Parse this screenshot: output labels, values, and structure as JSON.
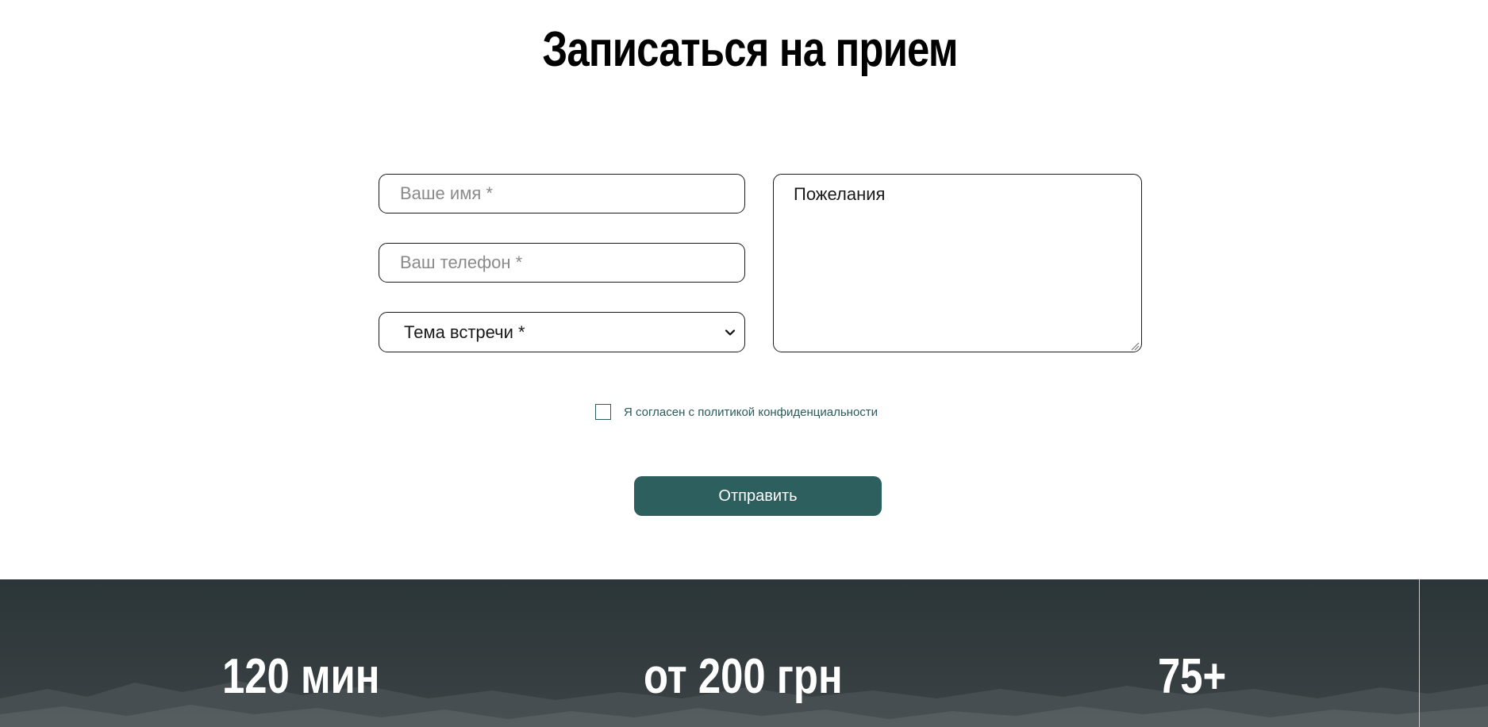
{
  "form": {
    "title": "Записаться на прием",
    "name_placeholder": "Ваше имя *",
    "phone_placeholder": "Ваш телефон *",
    "topic_selected": "Тема встречи *",
    "wishes_placeholder": "Пожелания",
    "consent_label": "Я согласен с политикой конфиденциальности",
    "consent_checked": false,
    "submit_label": "Отправить"
  },
  "stats": {
    "items": [
      {
        "value": "120 мин"
      },
      {
        "value": "от 200 грн"
      },
      {
        "value": "75+"
      }
    ]
  },
  "colors": {
    "accent": "#2c5f5d",
    "consent_text": "#2b5b5a",
    "stats_background": "#343b3e"
  }
}
